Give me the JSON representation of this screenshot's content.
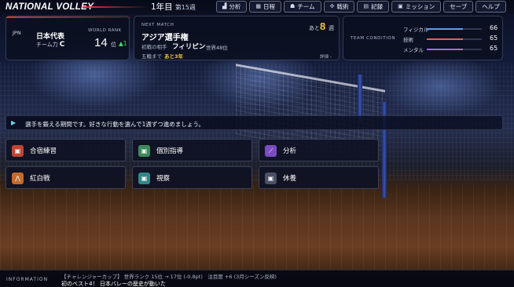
{
  "app": {
    "title": "NATIONAL VOLLEY"
  },
  "calendar": {
    "year": "1年目",
    "week": "第15週"
  },
  "menu": [
    {
      "label": "分析",
      "icon": "chart-icon",
      "glyph": "▟"
    },
    {
      "label": "日程",
      "icon": "calendar-icon",
      "glyph": "▦"
    },
    {
      "label": "チーム",
      "icon": "team-icon",
      "glyph": "☗"
    },
    {
      "label": "戦術",
      "icon": "tactics-icon",
      "glyph": "✣"
    },
    {
      "label": "記録",
      "icon": "record-icon",
      "glyph": "▤"
    },
    {
      "label": "ミッション",
      "icon": "mission-icon",
      "glyph": "▣"
    },
    {
      "label": "セーブ",
      "icon": "",
      "glyph": ""
    },
    {
      "label": "ヘルプ",
      "icon": "",
      "glyph": ""
    }
  ],
  "team": {
    "flag_alt": "JPN",
    "name": "日本代表",
    "power_label": "チーム力",
    "power_grade": "C",
    "world_rank_label": "WORLD RANK",
    "world_rank": "14",
    "world_rank_unit": "位",
    "world_rank_delta": "▲1",
    "accent": "#d93535"
  },
  "next_match": {
    "label": "NEXT MATCH",
    "title": "アジア選手権",
    "opponent_label": "初戦の相手",
    "opponent": "フィリピン",
    "opponent_rank": "世界48位",
    "olympics_label": "五輪まで",
    "olympics_value": "あと3年",
    "weeks_prefix": "あと",
    "weeks_value": "8",
    "weeks_unit": "週",
    "detail_link": "詳細 ›"
  },
  "condition": {
    "label": "TEAM CONDITION",
    "stats": [
      {
        "name": "フィジカル",
        "value": 66,
        "color": "#5b9cf0"
      },
      {
        "name": "技術",
        "value": 65,
        "color": "#e45c5c"
      },
      {
        "name": "メンタル",
        "value": 65,
        "color": "#a46ae8"
      }
    ]
  },
  "period": {
    "text": "選手を鍛える期間です。好きな行動を選んで1週ずつ進めましょう。"
  },
  "actions": [
    {
      "label": "合宿練習",
      "icon": "training-icon",
      "glyph": "▣",
      "color": "#c0442f"
    },
    {
      "label": "個別指導",
      "icon": "coaching-icon",
      "glyph": "▣",
      "color": "#3f8a5a"
    },
    {
      "label": "分析",
      "icon": "analysis-icon",
      "glyph": "⟋",
      "color": "#7b4cc4"
    },
    {
      "label": "紅白戦",
      "icon": "scrimmage-icon",
      "glyph": "⋀",
      "color": "#c46a2c"
    },
    {
      "label": "視察",
      "icon": "scouting-icon",
      "glyph": "▣",
      "color": "#2f8a86"
    },
    {
      "label": "休養",
      "icon": "rest-icon",
      "glyph": "▣",
      "color": "#4a5066"
    }
  ],
  "info": {
    "label": "INFORMATION",
    "line1": "【チャレンジャーカップ】 世界ランク 15位 → 17位 (-0.8pt)　注目度 +6 (3月シーズン反映)",
    "line2": "初のベスト4！ 日本バレーの歴史が動いた"
  }
}
